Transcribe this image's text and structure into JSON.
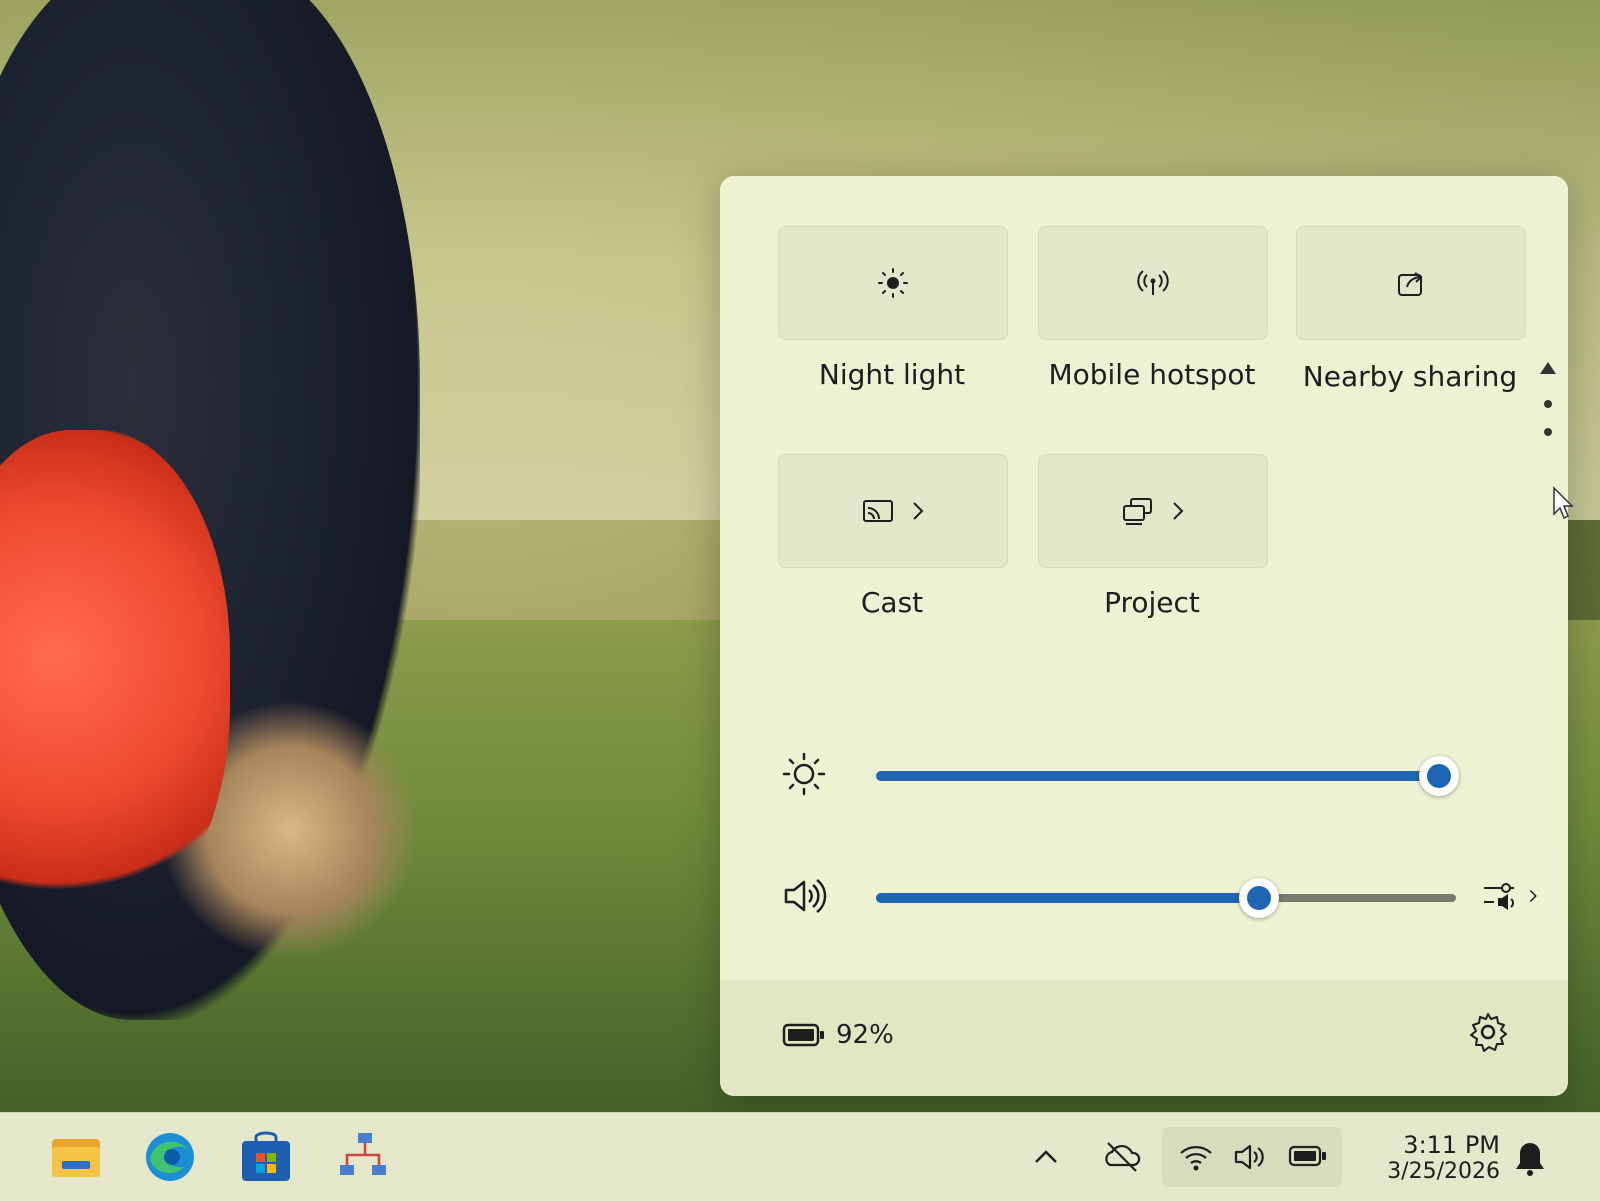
{
  "quick_settings": {
    "tiles": [
      {
        "label": "Night light",
        "icon": "night-light-icon",
        "has_chevron": false
      },
      {
        "label": "Mobile hotspot",
        "icon": "mobile-hotspot-icon",
        "has_chevron": false
      },
      {
        "label": "Nearby sharing",
        "icon": "nearby-sharing-icon",
        "has_chevron": false
      },
      {
        "label": "Cast",
        "icon": "cast-icon",
        "has_chevron": true
      },
      {
        "label": "Project",
        "icon": "project-icon",
        "has_chevron": true
      }
    ],
    "brightness": {
      "icon": "brightness-icon",
      "value_percent": 97
    },
    "volume": {
      "icon": "speaker-icon",
      "value_percent": 66
    },
    "battery": {
      "percent_text": "92%",
      "icon": "battery-icon"
    },
    "settings_icon": "gear-icon"
  },
  "taskbar": {
    "icons": [
      "file-explorer-icon",
      "edge-browser-icon",
      "microsoft-store-icon",
      "network-app-icon"
    ],
    "tray_icons": [
      "show-hidden-icons-chevron",
      "onedrive-paused-icon",
      "wifi-icon",
      "volume-icon",
      "battery-icon"
    ],
    "clock": {
      "time": "3:11 PM",
      "date": "3/25/2026"
    },
    "notification_icon": "notification-bell-icon"
  },
  "colors": {
    "accent": "#1e66b4",
    "panel_bg": "#eef2d3",
    "taskbar_bg": "#e4e7c9"
  }
}
